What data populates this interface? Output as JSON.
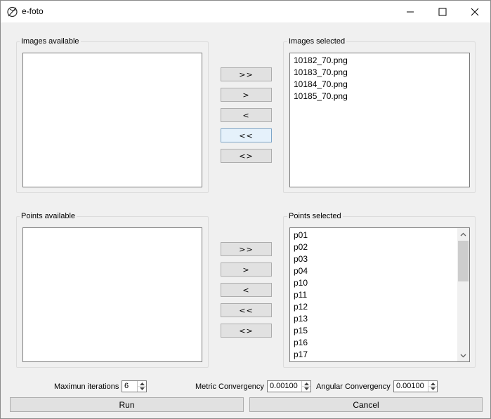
{
  "window": {
    "title": "e-foto",
    "icons": {
      "app": "e-foto-logo-icon",
      "minimize": "minimize-icon",
      "maximize": "maximize-icon",
      "close": "close-icon"
    }
  },
  "images": {
    "available_label": "Images available",
    "selected_label": "Images selected",
    "available": [],
    "selected": [
      "10182_70.png",
      "10183_70.png",
      "10184_70.png",
      "10185_70.png"
    ],
    "buttons": [
      ">>",
      ">",
      "<",
      "<<",
      "<>"
    ]
  },
  "points": {
    "available_label": "Points available",
    "selected_label": "Points selected",
    "available": [],
    "selected": [
      "p01",
      "p02",
      "p03",
      "p04",
      "p10",
      "p11",
      "p12",
      "p13",
      "p15",
      "p16",
      "p17"
    ],
    "buttons": [
      ">>",
      ">",
      "<",
      "<<",
      "<>"
    ]
  },
  "params": {
    "max_iterations_label": "Maximun iterations",
    "max_iterations_value": "6",
    "metric_label": "Metric Convergency",
    "metric_value": "0.00100",
    "angular_label": "Angular Convergency",
    "angular_value": "0.00100"
  },
  "actions": {
    "run": "Run",
    "cancel": "Cancel"
  }
}
